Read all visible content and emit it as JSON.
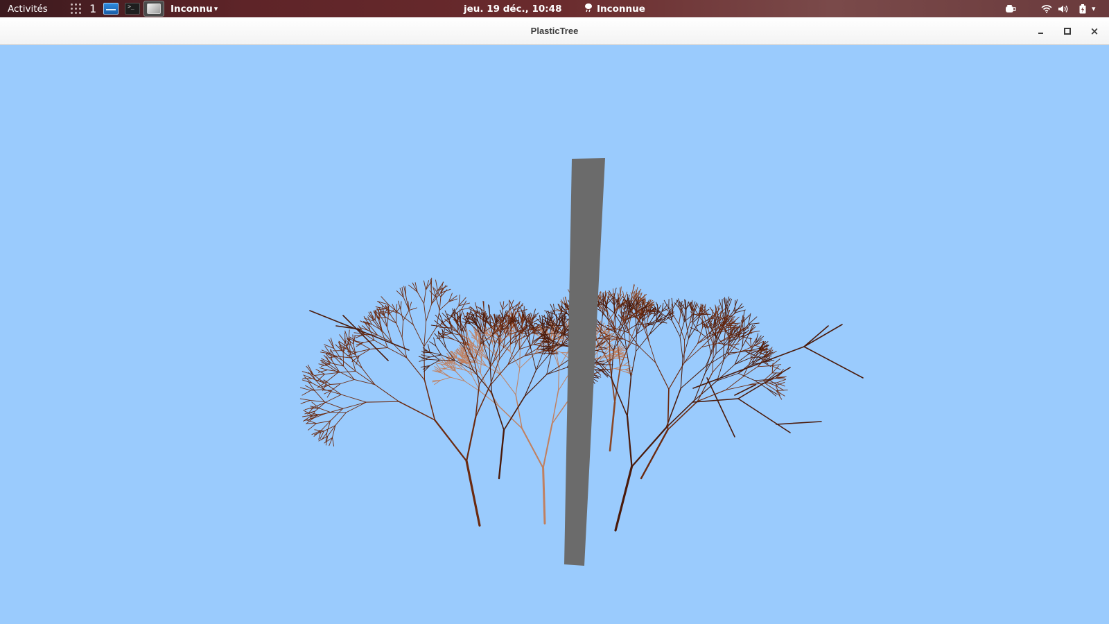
{
  "topbar": {
    "activities_label": "Activités",
    "apps_icon": "apps-grid-icon",
    "workspace_number": "1",
    "app_menu_label": "Inconnu",
    "app_menu_arrow": "▾",
    "clock": "jeu. 19 déc., 10:48",
    "weather_icon": "cloud-rain-icon",
    "weather_label": "Inconnue",
    "status_icons": [
      "coffee-cup-icon",
      "wifi-icon",
      "volume-icon",
      "battery-icon",
      "menu-arrow-icon"
    ],
    "status_arrow": "▾"
  },
  "window": {
    "title": "PlasticTree",
    "minimize_icon": "minimize-icon",
    "maximize_icon": "maximize-icon",
    "close_icon": "close-icon",
    "close_glyph": "×"
  },
  "scene": {
    "background_color": "#9acbfd",
    "pillar_color": "#6b6b6b",
    "branch_colors": [
      "#4a1a0a",
      "#6b2a10",
      "#8a4828",
      "#c08060"
    ]
  }
}
